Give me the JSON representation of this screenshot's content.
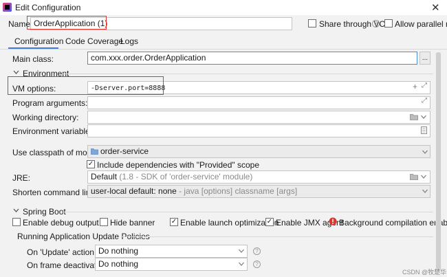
{
  "window": {
    "title": "Edit Configuration",
    "close_glyph": "✕"
  },
  "header": {
    "name_label": "Name:",
    "name_value": "OrderApplication (1)",
    "share_label": "Share through VCS",
    "share_checked": false,
    "parallel_label": "Allow parallel run",
    "parallel_checked": false
  },
  "tabs": [
    {
      "label": "Configuration",
      "active": true
    },
    {
      "label": "Code Coverage",
      "active": false
    },
    {
      "label": "Logs",
      "active": false
    }
  ],
  "form": {
    "main_class_label": "Main class:",
    "main_class_value": "com.xxx.order.OrderApplication",
    "browse_label": "...",
    "environment_label": "Environment",
    "vm_options_label": "VM options:",
    "vm_options_value": "-Dserver.port=8888",
    "program_args_label": "Program arguments:",
    "working_dir_label": "Working directory:",
    "env_vars_label": "Environment variables:",
    "classpath_label": "Use classpath of module:",
    "classpath_value": "order-service",
    "include_deps_label": "Include dependencies with \"Provided\" scope",
    "include_deps_checked": true,
    "jre_label": "JRE:",
    "jre_value": "Default",
    "jre_hint": "(1.8 - SDK of 'order-service' module)",
    "shorten_label": "Shorten command line:",
    "shorten_value": "user-local default: none",
    "shorten_hint": "- java [options] classname [args]"
  },
  "spring_boot": {
    "section_label": "Spring Boot",
    "debug_label": "Enable debug output",
    "debug_checked": false,
    "hide_banner_label": "Hide banner",
    "hide_banner_checked": false,
    "launch_opt_label": "Enable launch optimization",
    "launch_opt_checked": true,
    "jmx_label": "Enable JMX agent",
    "jmx_checked": true,
    "bg_compile_label": "Background compilation enabled",
    "policies_label": "Running Application Update Policies",
    "on_update_label": "On 'Update' action:",
    "on_update_value": "Do nothing",
    "on_frame_label": "On frame deactivation:",
    "on_frame_value": "Do nothing"
  },
  "watermark": "CSDN @牧楚华",
  "colors": {
    "accent": "#3d7bd6",
    "highlight_box": "#e0352b",
    "error": "#e0352b"
  }
}
